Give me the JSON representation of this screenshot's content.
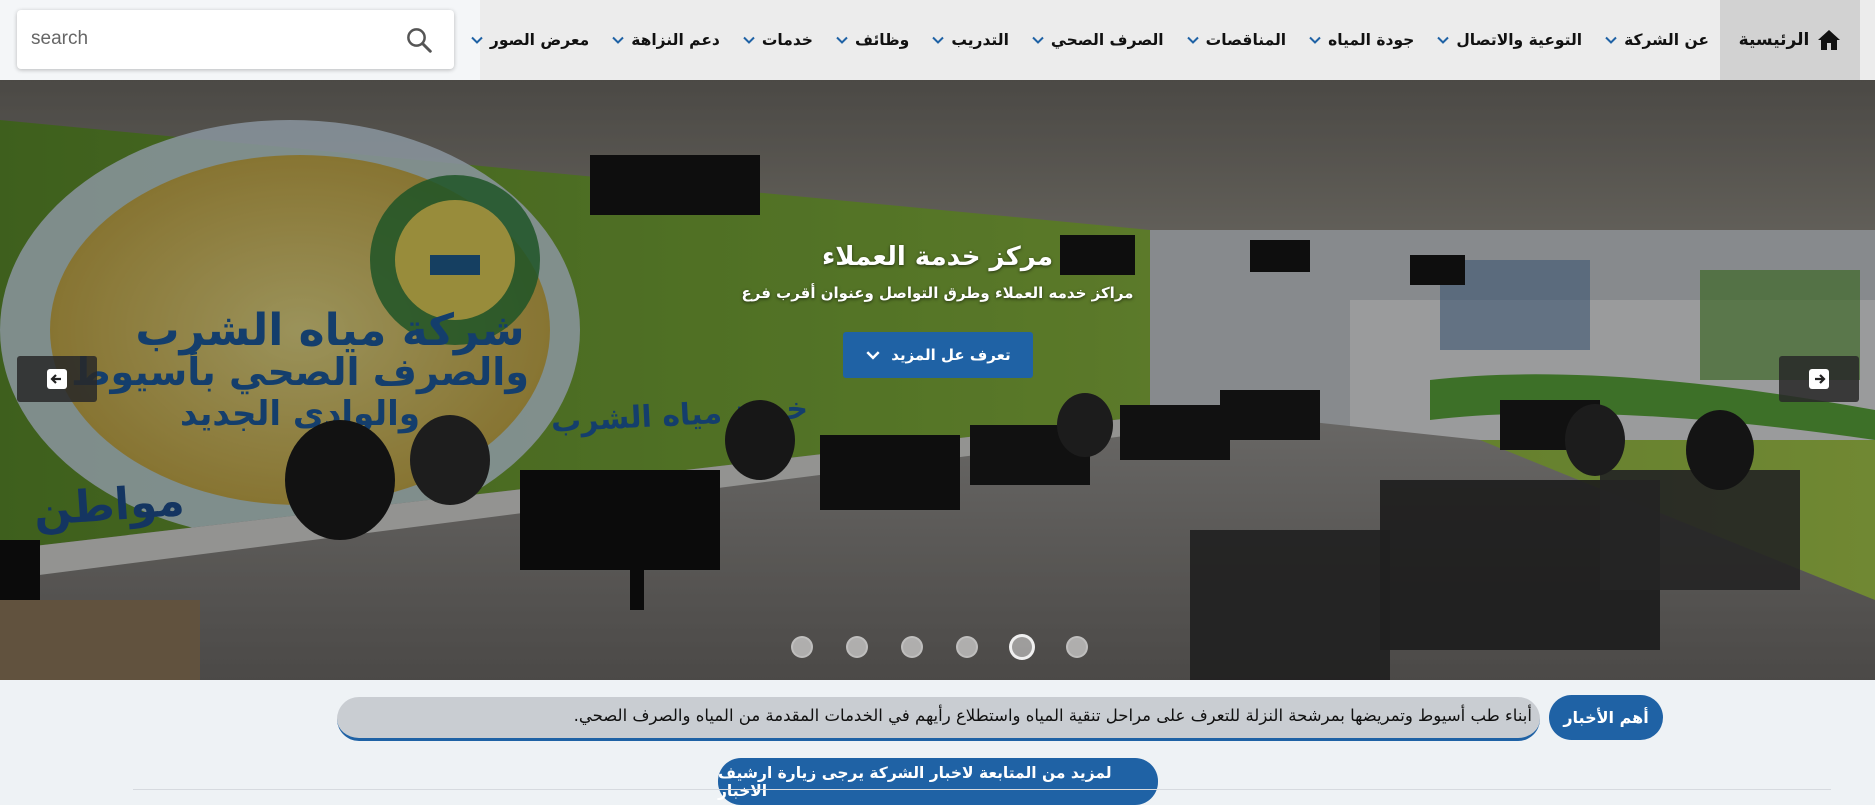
{
  "search": {
    "placeholder": "search"
  },
  "nav": {
    "home_label": "الرئيسية",
    "items": [
      {
        "label": "عن الشركة"
      },
      {
        "label": "التوعية والاتصال"
      },
      {
        "label": "جودة المياه"
      },
      {
        "label": "المناقصات"
      },
      {
        "label": "الصرف الصحي"
      },
      {
        "label": "التدريب"
      },
      {
        "label": "وظائف"
      },
      {
        "label": "خدمات"
      },
      {
        "label": "دعم النزاهة"
      },
      {
        "label": "معرض الصور"
      }
    ]
  },
  "hero": {
    "title": "مركز خدمة العملاء",
    "subtitle": "مراكز خدمه العملاء وطرق التواصل وعنوان أقرب فرع",
    "button_label": "تعرف عل المزيد",
    "slide_count": 6,
    "active_slide": 5,
    "sign_line1": "شركة مياه الشرب",
    "sign_line2": "والصرف الصحي بأسيوط",
    "sign_line3": "والوادى الجديد",
    "sign_service": "خدمة مياه الشرب",
    "sign_citizen": "مواطن"
  },
  "news": {
    "label": "أهم الأخبار",
    "ticker_text": "أبناء طب أسيوط وتمريضها بمرشحة النزلة للتعرف على مراحل تنقية المياه واستطلاع رأيهم في الخدمات المقدمة من المياه والصرف الصحي.",
    "archive_label": "لمزيد من المتابعة لاخبار الشركة يرجى زيارة ارشيف الاخبار"
  },
  "colors": {
    "accent": "#1f62a5",
    "nav_bg": "#ececec",
    "home_bg": "#d2d2d2"
  },
  "icons": {
    "search": "search-icon",
    "home": "home-icon",
    "chevron": "chevron-down-icon",
    "prev": "arrow-left-icon",
    "next": "arrow-right-icon"
  }
}
